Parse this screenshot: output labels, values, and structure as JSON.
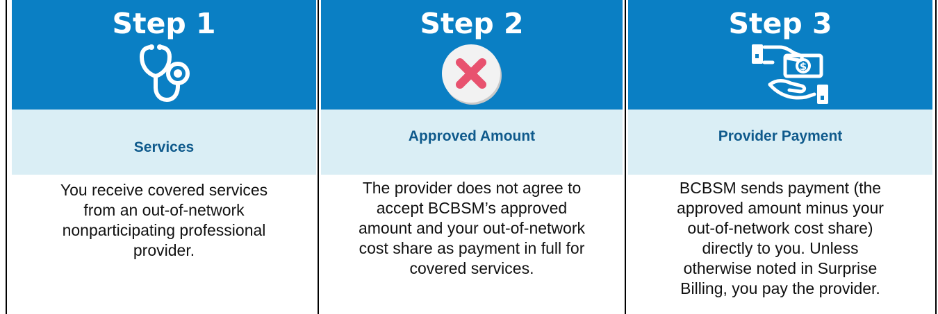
{
  "steps": [
    {
      "title": "Step 1",
      "icon": "stethoscope-icon",
      "heading": "Services",
      "lines": [
        "You receive covered services",
        "from an out-of-network",
        "nonparticipating professional",
        "provider."
      ]
    },
    {
      "title": "Step 2",
      "icon": "close-circle-icon",
      "heading": "Approved Amount",
      "lines": [
        "The provider does not agree to",
        "accept BCBSM’s approved",
        "amount and your out-of-network",
        "cost share as payment in full for",
        "covered services."
      ]
    },
    {
      "title": "Step 3",
      "icon": "money-transfer-icon",
      "heading": "Provider Payment",
      "lines": [
        "BCBSM sends payment (the",
        "approved amount minus your",
        "out-of-network cost share)",
        "directly to you. Unless",
        "otherwise noted in Surprise",
        "Billing, you pay the provider."
      ]
    }
  ],
  "colors": {
    "header": "#0a7fc4",
    "band": "#daeef5",
    "heading_text": "#0f5a8c",
    "close_icon": "#e8526f"
  }
}
